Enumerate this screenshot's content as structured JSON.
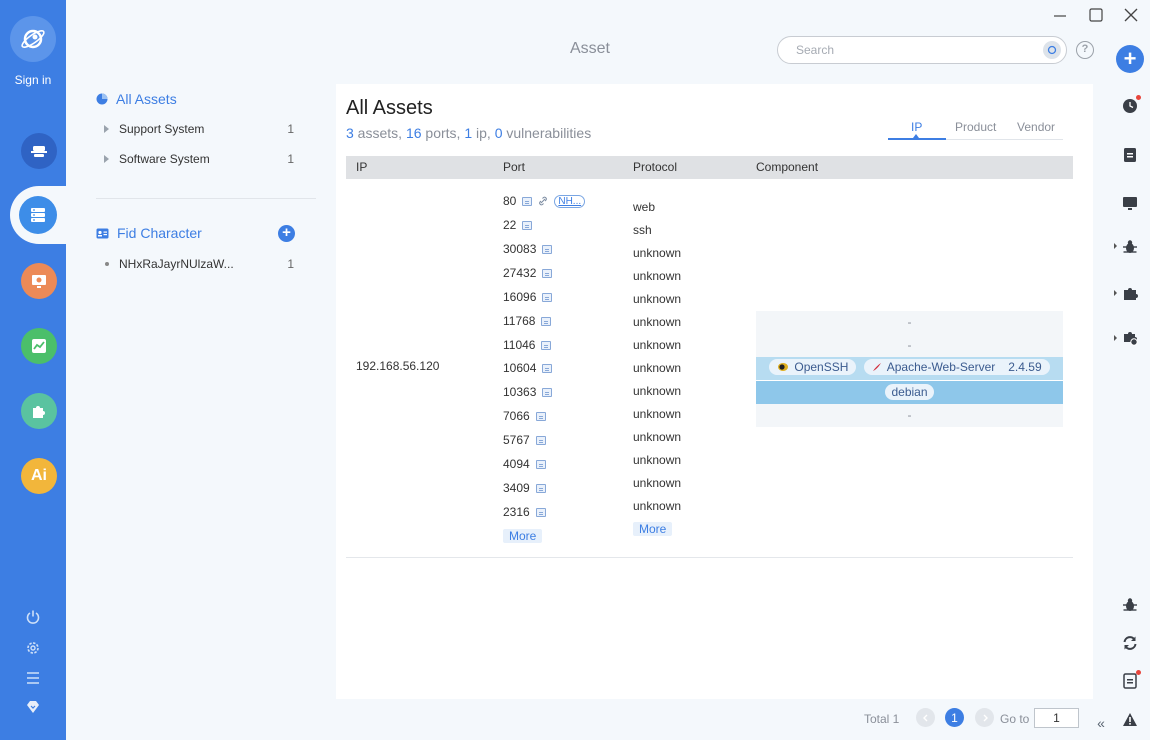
{
  "sidebar": {
    "sign_in": "Sign in"
  },
  "window": {
    "title": "Asset"
  },
  "search": {
    "placeholder": "Search"
  },
  "tree": {
    "all_assets": "All Assets",
    "items": [
      {
        "label": "Support System",
        "count": "1"
      },
      {
        "label": "Software System",
        "count": "1"
      }
    ],
    "fid_title": "Fid Character",
    "fid_items": [
      {
        "label": "NHxRaJayrNUlzaW...",
        "count": "1"
      }
    ]
  },
  "main": {
    "title": "All Assets",
    "summary": {
      "assets_n": "3",
      "assets_w": " assets, ",
      "ports_n": "16",
      "ports_w": " ports, ",
      "ip_n": "1",
      "ip_w": " ip, ",
      "vuln_n": "0",
      "vuln_w": " vulnerabilities"
    },
    "tabs": [
      "IP",
      "Product",
      "Vendor"
    ],
    "columns": [
      "IP",
      "Port",
      "Protocol",
      "Component"
    ],
    "ip": "192.168.56.120",
    "nh_badge": "NH...",
    "ports": [
      "80",
      "22",
      "30083",
      "27432",
      "16096",
      "11768",
      "11046",
      "10604",
      "10363",
      "7066",
      "5767",
      "4094",
      "3409",
      "2316"
    ],
    "protocols": [
      "web",
      "ssh",
      "unknown",
      "unknown",
      "unknown",
      "unknown",
      "unknown",
      "unknown",
      "unknown",
      "unknown",
      "unknown",
      "unknown",
      "unknown",
      "unknown"
    ],
    "more": "More",
    "components": {
      "dash": "-",
      "openssh": "OpenSSH",
      "apache": "Apache-Web-Server",
      "apache_version": "2.4.59",
      "debian": "debian"
    }
  },
  "pagination": {
    "total": "Total 1",
    "current": "1",
    "goto_label": "Go to",
    "goto_value": "1"
  },
  "colors": {
    "accent": "#3d7ee3",
    "sidebar": "#3d7ee3",
    "highlight": "#b7dcf1"
  }
}
